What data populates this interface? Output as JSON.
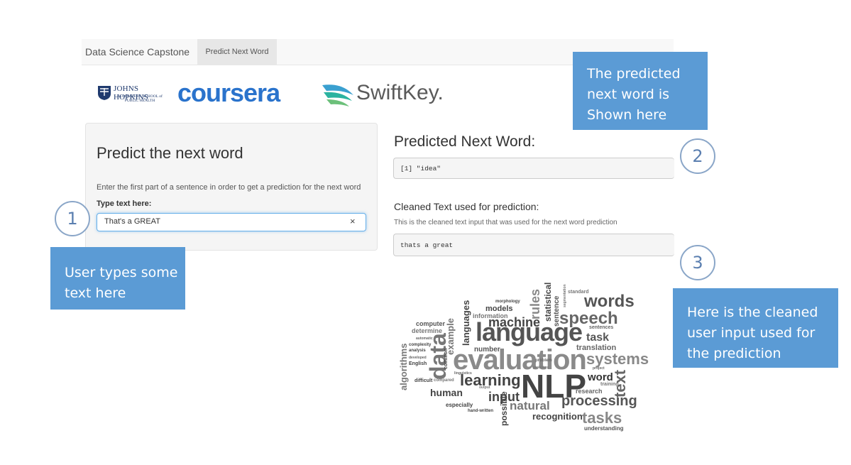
{
  "navbar": {
    "brand": "Data Science Capstone",
    "active_tab": "Predict Next Word"
  },
  "logos": {
    "jhu_line1": "JOHNS HOPKINS",
    "jhu_line2": "BLOOMBERG SCHOOL of PUBLIC HEALTH",
    "coursera": "coursera",
    "swiftkey": "SwiftKey."
  },
  "sidebar": {
    "title": "Predict the next word",
    "help_text": "Enter the first part of a sentence in order to get a prediction for the next word",
    "input_label": "Type text here:",
    "input_value": "That's a GREAT",
    "clear_icon": "×"
  },
  "main": {
    "prediction_heading": "Predicted Next Word:",
    "prediction_output": "[1] \"idea\"",
    "cleaned_heading": "Cleaned Text used for prediction:",
    "cleaned_help": "This is the cleaned text input that was used for the next word prediction",
    "cleaned_output": "thats a great"
  },
  "annotations": {
    "callout_1": "User types some text here",
    "callout_2": "The predicted next word is Shown here",
    "callout_3": "Here is the cleaned user input used for the prediction",
    "marker_1": "1",
    "marker_2": "2",
    "marker_3": "3"
  },
  "wordcloud": {
    "words": [
      "language",
      "evaluation",
      "NLP",
      "data",
      "learning",
      "speech",
      "words",
      "systems",
      "machine",
      "processing",
      "tasks",
      "input",
      "natural",
      "human",
      "recognition",
      "text",
      "task",
      "word",
      "rules",
      "statistical",
      "sentence",
      "translation",
      "models",
      "languages",
      "example",
      "algorithms",
      "possible",
      "number",
      "computer",
      "determine",
      "complexity",
      "analysis",
      "English",
      "common",
      "research",
      "training",
      "understanding",
      "especially",
      "information",
      "segmentation",
      "standard",
      "sentences",
      "morphology",
      "project",
      "problem",
      "compared",
      "output",
      "difficult",
      "automatic",
      "developed",
      "hand-written",
      "linguistics",
      "problems"
    ]
  },
  "colors": {
    "callout_bg": "#5b9bd5",
    "coursera_blue": "#2a73cc",
    "input_focus": "#66afe9"
  }
}
